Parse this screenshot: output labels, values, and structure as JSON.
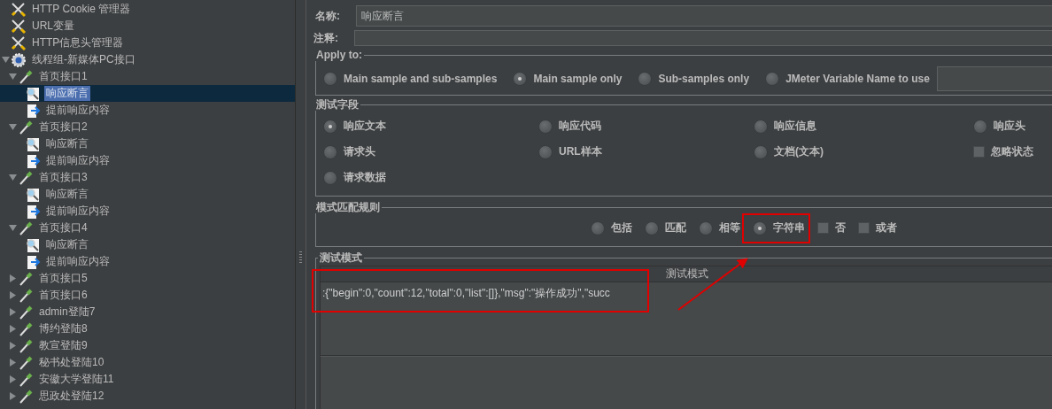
{
  "tree": [
    {
      "kind": "config",
      "label": "HTTP Cookie 管理器",
      "selected": false
    },
    {
      "kind": "config",
      "label": "URL变量",
      "selected": false
    },
    {
      "kind": "config",
      "label": "HTTP信息头管理器",
      "selected": false
    },
    {
      "kind": "thread_group",
      "label": "线程组-新媒体PC接口",
      "selected": false,
      "expanded": true,
      "children": [
        {
          "kind": "sampler",
          "label": "首页接口1",
          "selected": false,
          "expanded": true,
          "children": [
            {
              "kind": "assertion",
              "label": "响应断言",
              "selected": true
            },
            {
              "kind": "extractor",
              "label": "提前响应内容",
              "selected": false
            }
          ]
        },
        {
          "kind": "sampler",
          "label": "首页接口2",
          "selected": false,
          "expanded": true,
          "children": [
            {
              "kind": "assertion",
              "label": "响应断言",
              "selected": false
            },
            {
              "kind": "extractor",
              "label": "提前响应内容",
              "selected": false
            }
          ]
        },
        {
          "kind": "sampler",
          "label": "首页接口3",
          "selected": false,
          "expanded": true,
          "children": [
            {
              "kind": "assertion",
              "label": "响应断言",
              "selected": false
            },
            {
              "kind": "extractor",
              "label": "提前响应内容",
              "selected": false
            }
          ]
        },
        {
          "kind": "sampler",
          "label": "首页接口4",
          "selected": false,
          "expanded": true,
          "children": [
            {
              "kind": "assertion",
              "label": "响应断言",
              "selected": false
            },
            {
              "kind": "extractor",
              "label": "提前响应内容",
              "selected": false
            }
          ]
        },
        {
          "kind": "sampler",
          "label": "首页接口5",
          "selected": false,
          "expanded": false
        },
        {
          "kind": "sampler",
          "label": "首页接口6",
          "selected": false,
          "expanded": false
        },
        {
          "kind": "sampler",
          "label": "admin登陆7",
          "selected": false,
          "expanded": false
        },
        {
          "kind": "sampler",
          "label": "博约登陆8",
          "selected": false,
          "expanded": false
        },
        {
          "kind": "sampler",
          "label": "教宣登陆9",
          "selected": false,
          "expanded": false
        },
        {
          "kind": "sampler",
          "label": "秘书处登陆10",
          "selected": false,
          "expanded": false
        },
        {
          "kind": "sampler",
          "label": "安徽大学登陆11",
          "selected": false,
          "expanded": false
        },
        {
          "kind": "sampler",
          "label": "思政处登陆12",
          "selected": false,
          "expanded": false
        }
      ]
    }
  ],
  "name": {
    "label": "名称:",
    "value": "响应断言"
  },
  "comment": {
    "label": "注释:"
  },
  "apply_to": {
    "title": "Apply to:",
    "options": [
      {
        "label": "Main sample and sub-samples",
        "selected": false
      },
      {
        "label": "Main sample only",
        "selected": true
      },
      {
        "label": "Sub-samples only",
        "selected": false
      },
      {
        "label": "JMeter Variable Name to use",
        "selected": false
      }
    ]
  },
  "test_field": {
    "title": "测试字段",
    "options": [
      {
        "kind": "radio",
        "label": "响应文本",
        "selected": true
      },
      {
        "kind": "radio",
        "label": "响应代码",
        "selected": false
      },
      {
        "kind": "radio",
        "label": "响应信息",
        "selected": false
      },
      {
        "kind": "radio",
        "label": "响应头",
        "selected": false
      },
      {
        "kind": "radio",
        "label": "请求头",
        "selected": false
      },
      {
        "kind": "radio",
        "label": "URL样本",
        "selected": false
      },
      {
        "kind": "radio",
        "label": "文档(文本)",
        "selected": false
      },
      {
        "kind": "checkbox",
        "label": "忽略状态",
        "checked": false
      },
      {
        "kind": "radio",
        "label": "请求数据",
        "selected": false
      }
    ]
  },
  "match_rules": {
    "title": "模式匹配规则",
    "options": [
      {
        "kind": "radio",
        "label": "包括",
        "selected": false,
        "highlighted": false
      },
      {
        "kind": "radio",
        "label": "匹配",
        "selected": false,
        "highlighted": false
      },
      {
        "kind": "radio",
        "label": "相等",
        "selected": false,
        "highlighted": false
      },
      {
        "kind": "radio",
        "label": "字符串",
        "selected": true,
        "highlighted": true
      },
      {
        "kind": "checkbox",
        "label": "否",
        "checked": false,
        "highlighted": false
      },
      {
        "kind": "checkbox",
        "label": "或者",
        "checked": false,
        "highlighted": false
      }
    ]
  },
  "patterns": {
    "title": "测试模式",
    "column": "测试模式",
    "rows": [
      {
        "text": ":{\"begin\":0,\"count\":12,\"total\":0,\"list\":[]},\"msg\":\"操作成功\",\"succ",
        "highlighted": true
      }
    ]
  }
}
